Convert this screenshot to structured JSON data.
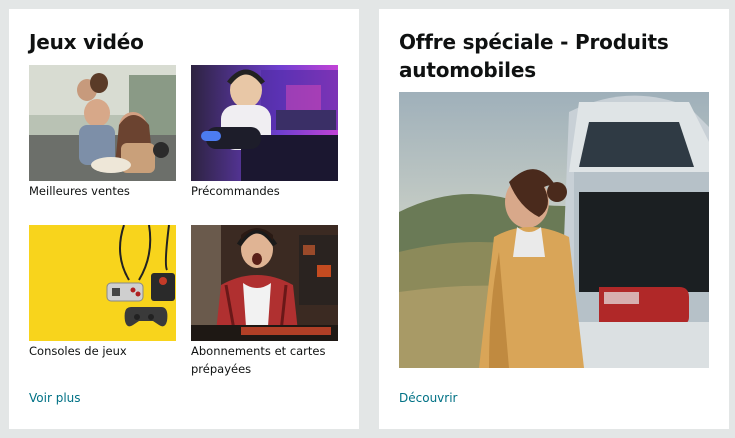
{
  "gaming": {
    "title": "Jeux vidéo",
    "tiles": [
      {
        "label": "Meilleures ventes"
      },
      {
        "label": "Précommandes"
      },
      {
        "label": "Consoles de jeux"
      },
      {
        "label": "Abonnements et cartes prépayées"
      }
    ],
    "see_more": "Voir plus"
  },
  "auto": {
    "title": "Offre spéciale - Produits automobiles",
    "cta": "Découvrir"
  },
  "colors": {
    "page_bg": "#e3e6e6",
    "card_bg": "#ffffff",
    "link": "#007185"
  }
}
